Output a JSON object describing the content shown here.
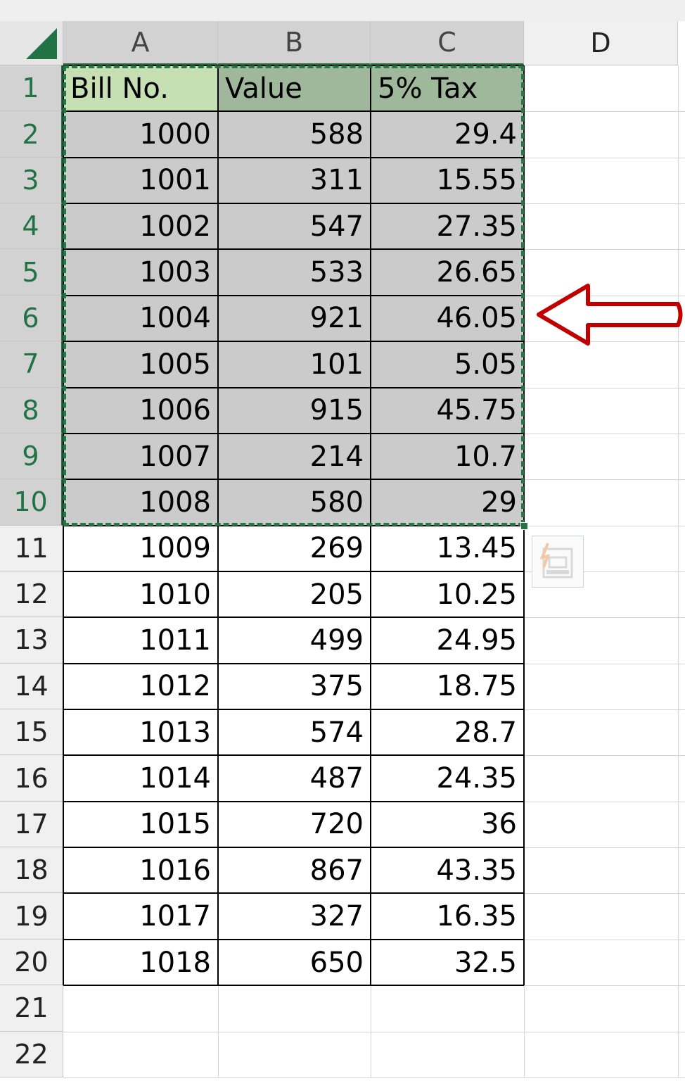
{
  "columns": [
    "A",
    "B",
    "C",
    "D"
  ],
  "rows": [
    "1",
    "2",
    "3",
    "4",
    "5",
    "6",
    "7",
    "8",
    "9",
    "10",
    "11",
    "12",
    "13",
    "14",
    "15",
    "16",
    "17",
    "18",
    "19",
    "20",
    "21",
    "22"
  ],
  "table": {
    "headers": [
      "Bill No.",
      "Value",
      "5% Tax"
    ],
    "rows": [
      [
        "1000",
        "588",
        "29.4"
      ],
      [
        "1001",
        "311",
        "15.55"
      ],
      [
        "1002",
        "547",
        "27.35"
      ],
      [
        "1003",
        "533",
        "26.65"
      ],
      [
        "1004",
        "921",
        "46.05"
      ],
      [
        "1005",
        "101",
        "5.05"
      ],
      [
        "1006",
        "915",
        "45.75"
      ],
      [
        "1007",
        "214",
        "10.7"
      ],
      [
        "1008",
        "580",
        "29"
      ],
      [
        "1009",
        "269",
        "13.45"
      ],
      [
        "1010",
        "205",
        "10.25"
      ],
      [
        "1011",
        "499",
        "24.95"
      ],
      [
        "1012",
        "375",
        "18.75"
      ],
      [
        "1013",
        "574",
        "28.7"
      ],
      [
        "1014",
        "487",
        "24.35"
      ],
      [
        "1015",
        "720",
        "36"
      ],
      [
        "1016",
        "867",
        "43.35"
      ],
      [
        "1017",
        "327",
        "16.35"
      ],
      [
        "1018",
        "650",
        "32.5"
      ]
    ]
  },
  "selection": {
    "range": "A1:C10",
    "selected_columns": [
      "A",
      "B",
      "C"
    ],
    "selected_rows": [
      "1",
      "2",
      "3",
      "4",
      "5",
      "6",
      "7",
      "8",
      "9",
      "10"
    ]
  },
  "icons": {
    "select_all": "select-all-triangle-icon",
    "quick_analysis": "quick-analysis-icon",
    "annotation": "left-arrow-icon"
  },
  "colors": {
    "accent": "#217346",
    "header_a1": "#c6e0b4",
    "header_b1_c1": "#9fb79a",
    "selected_fill": "#cbcbcb",
    "arrow": "#c00000"
  }
}
